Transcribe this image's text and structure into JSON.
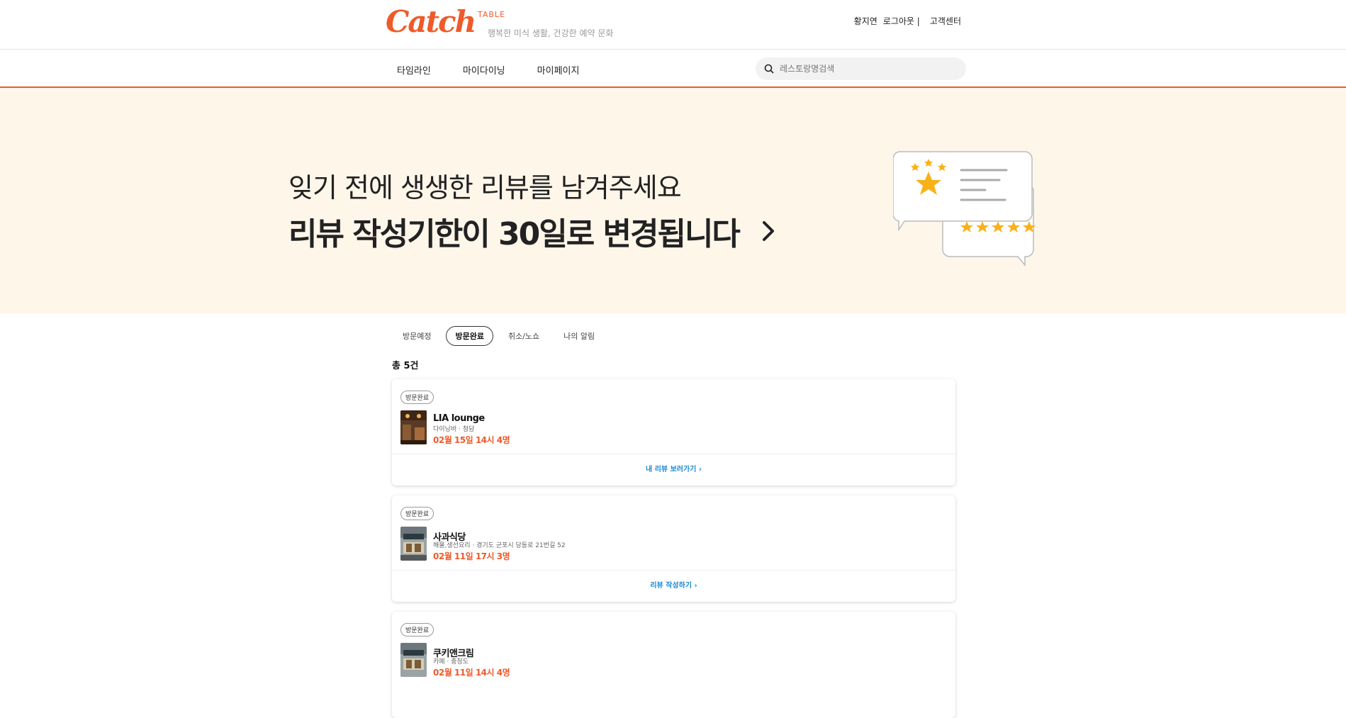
{
  "header": {
    "logo_word": "Catch",
    "logo_sub": "TABLE",
    "slogan": "행복한 미식 생활, 건강한 예약 문화",
    "user_name": "황지연",
    "logout": "로그아웃 |",
    "support": "고객센터"
  },
  "nav": {
    "items": [
      {
        "label": "타임라인"
      },
      {
        "label": "마이다이닝"
      },
      {
        "label": "마이페이지"
      }
    ]
  },
  "search": {
    "placeholder": "레스토랑명검색"
  },
  "banner": {
    "line1": "잊기 전에 생생한 리뷰를 남겨주세요",
    "line2": "리뷰 작성기한이 30일로 변경됩니다"
  },
  "tabs": [
    {
      "label": "방문예정"
    },
    {
      "label": "방문완료"
    },
    {
      "label": "취소/노쇼"
    },
    {
      "label": "나의 알림"
    }
  ],
  "total": "총 5건",
  "cards": [
    {
      "badge": "방문완료",
      "name": "LIA lounge",
      "category": "다이닝바 · 청담",
      "date": "02월 15일 14시 4명",
      "link": "내 리뷰 보러가기 ›"
    },
    {
      "badge": "방문완료",
      "name": "사과식당",
      "category": "해물,생선요리 · 경기도 군포시 당동로 21번길 52",
      "date": "02월 11일 17시 3명",
      "link": "리뷰 작성하기 ›"
    },
    {
      "badge": "방문완료",
      "name": "쿠키앤크림",
      "category": "카페 · 충청도",
      "date": "02월 11일 14시 4명",
      "link": ""
    }
  ],
  "colors": {
    "accent": "#ef5a2a",
    "banner_bg": "#fff6ea",
    "link": "#1a8ad6",
    "star": "#f9b11a"
  }
}
